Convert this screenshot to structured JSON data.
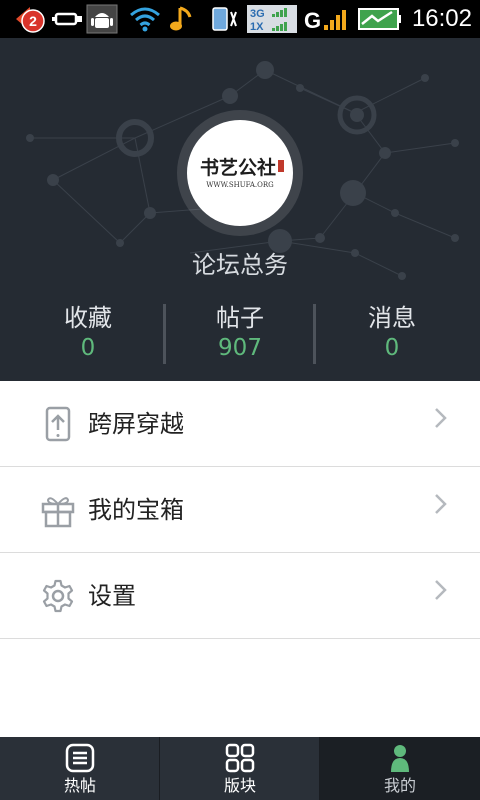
{
  "status_bar": {
    "notification_count": "2",
    "network_type_top": "3G",
    "network_type_bottom": "1X",
    "time": "16:02"
  },
  "profile": {
    "avatar_brand_text": "书艺公社",
    "avatar_url_text": "WWW.SHUFA.ORG",
    "username": "论坛总务",
    "stats": [
      {
        "label": "收藏",
        "value": "0"
      },
      {
        "label": "帖子",
        "value": "907"
      },
      {
        "label": "消息",
        "value": "0"
      }
    ]
  },
  "menu": {
    "items": [
      {
        "label": "跨屏穿越",
        "icon": "phone-upload-icon"
      },
      {
        "label": "我的宝箱",
        "icon": "gift-box-icon"
      },
      {
        "label": "设置",
        "icon": "gear-icon"
      }
    ]
  },
  "bottom_nav": {
    "tabs": [
      {
        "label": "热帖",
        "icon": "list-icon",
        "active": false
      },
      {
        "label": "版块",
        "icon": "grid-icon",
        "active": false
      },
      {
        "label": "我的",
        "icon": "person-icon",
        "active": true
      }
    ]
  },
  "colors": {
    "header_bg": "#252b33",
    "stat_value": "#5fb97c",
    "active_icon": "#5fb97c"
  }
}
